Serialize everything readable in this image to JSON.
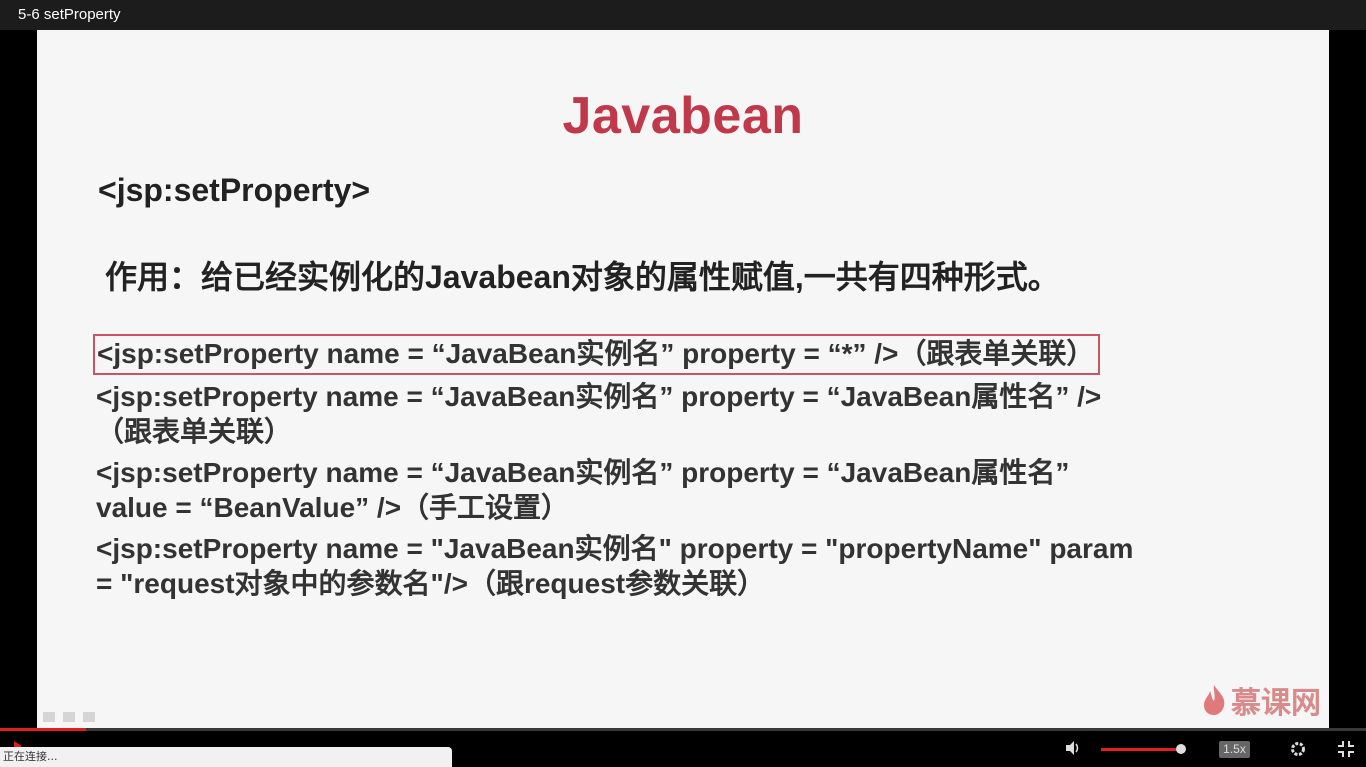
{
  "window": {
    "title": "5-6 setProperty"
  },
  "slide": {
    "title": "Javabean",
    "heading": "<jsp:setProperty>",
    "purpose": "作用：给已经实例化的Javabean对象的属性赋值,一共有四种形式。",
    "forms": [
      {
        "line1": "<jsp:setProperty name = “JavaBean实例名” property = “*” />（跟表单关联）"
      },
      {
        "line1": "<jsp:setProperty name = “JavaBean实例名” property = “JavaBean属性名” />",
        "line2": "（跟表单关联）"
      },
      {
        "line1": "<jsp:setProperty name = “JavaBean实例名” property = “JavaBean属性名”",
        "line2": "value = “BeanValue” />（手工设置）"
      },
      {
        "line1": "<jsp:setProperty name = \"JavaBean实例名\" property = \"propertyName\" param",
        "line2": "= \"request对象中的参数名\"/>（跟request参数关联）"
      }
    ],
    "logo_text": "慕课网"
  },
  "player": {
    "progress": 0.063,
    "volume": 0.98,
    "speed_label": "1.5x",
    "accent_color": "#e02020"
  },
  "status_bar": {
    "text": "正在连接..."
  }
}
